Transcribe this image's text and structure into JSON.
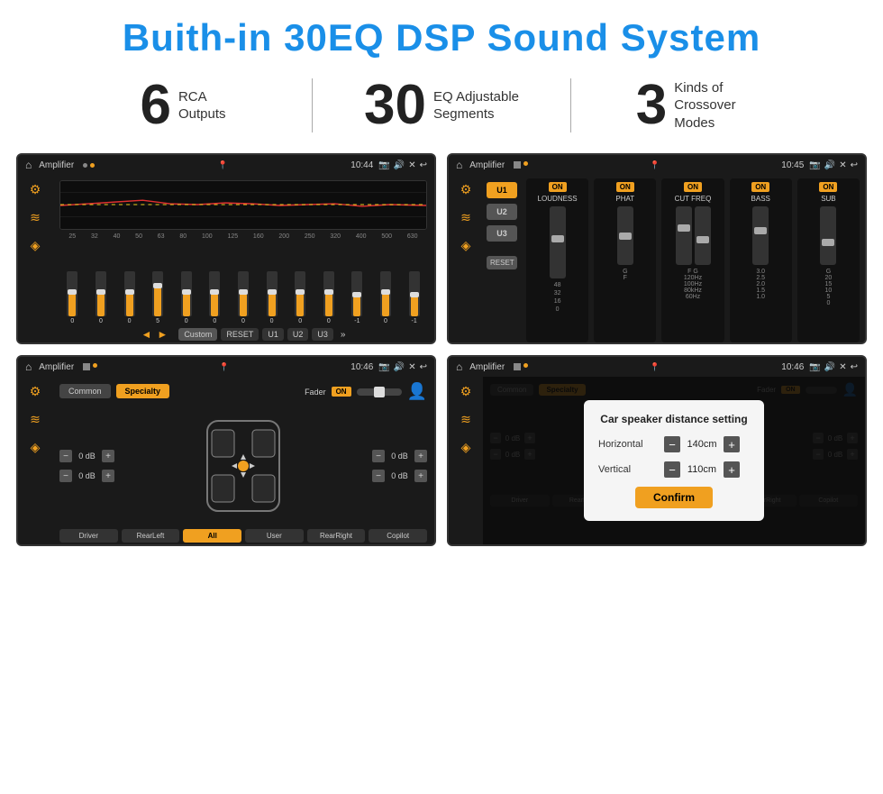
{
  "page": {
    "title": "Buith-in 30EQ DSP Sound System",
    "bg": "#ffffff"
  },
  "stats": [
    {
      "number": "6",
      "label": "RCA\nOutputs"
    },
    {
      "number": "30",
      "label": "EQ Adjustable\nSegments"
    },
    {
      "number": "3",
      "label": "Kinds of\nCrossover Modes"
    }
  ],
  "screens": {
    "eq": {
      "title": "Amplifier",
      "time": "10:44",
      "freqs": [
        "25",
        "32",
        "40",
        "50",
        "63",
        "80",
        "100",
        "125",
        "160",
        "200",
        "250",
        "320",
        "400",
        "500",
        "630"
      ],
      "values": [
        "0",
        "0",
        "0",
        "5",
        "0",
        "0",
        "0",
        "0",
        "0",
        "0",
        "0",
        "-1",
        "0",
        "-1"
      ],
      "preset": "Custom",
      "buttons": [
        "RESET",
        "U1",
        "U2",
        "U3"
      ]
    },
    "crossover": {
      "title": "Amplifier",
      "time": "10:45",
      "modes": [
        "U1",
        "U2",
        "U3"
      ],
      "modules": [
        {
          "label": "LOUDNESS",
          "on": true
        },
        {
          "label": "PHAT",
          "on": true
        },
        {
          "label": "CUT FREQ",
          "on": true
        },
        {
          "label": "BASS",
          "on": true
        },
        {
          "label": "SUB",
          "on": true
        }
      ]
    },
    "speaker": {
      "title": "Amplifier",
      "time": "10:46",
      "tabs": [
        "Common",
        "Specialty"
      ],
      "active_tab": "Specialty",
      "fader_label": "Fader",
      "fader_on": true,
      "controls": [
        {
          "val": "0 dB"
        },
        {
          "val": "0 dB"
        },
        {
          "val": "0 dB"
        },
        {
          "val": "0 dB"
        }
      ],
      "bottom_btns": [
        "Driver",
        "RearLeft",
        "All",
        "User",
        "RearRight",
        "Copilot"
      ]
    },
    "distance": {
      "title": "Amplifier",
      "time": "10:46",
      "dialog": {
        "title": "Car speaker distance setting",
        "horizontal_label": "Horizontal",
        "horizontal_val": "140cm",
        "vertical_label": "Vertical",
        "vertical_val": "110cm",
        "confirm_label": "Confirm"
      }
    }
  }
}
